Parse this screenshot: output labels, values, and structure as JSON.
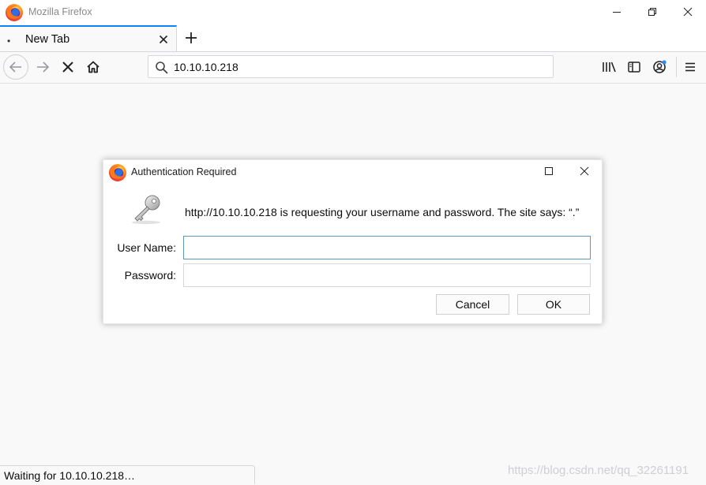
{
  "window": {
    "title": "Mozilla Firefox"
  },
  "tabs": [
    {
      "label": "New Tab",
      "bullet": "•"
    }
  ],
  "urlbar": {
    "value": "10.10.10.218"
  },
  "dialog": {
    "title": "Authentication Required",
    "message": "http://10.10.10.218 is requesting your username and password. The site says: “.”",
    "username_label": "User Name:",
    "username_value": "",
    "password_label": "Password:",
    "password_value": "",
    "cancel_label": "Cancel",
    "ok_label": "OK"
  },
  "status": {
    "text": "Waiting for 10.10.10.218…"
  },
  "watermark": {
    "text": "https://blog.csdn.net/qq_32261191"
  },
  "colors": {
    "accent": "#0a84ff",
    "focus_border": "#5b9bb5",
    "chrome_bg": "#f9f9fa"
  },
  "icons": {
    "app_logo": "firefox-logo-icon",
    "back": "back-arrow-icon",
    "forward": "forward-arrow-icon",
    "stop": "stop-icon",
    "home": "home-icon",
    "search": "search-icon",
    "library": "library-icon",
    "sidebar": "sidebar-icon",
    "account": "account-icon",
    "menu": "hamburger-menu-icon",
    "key": "key-icon"
  }
}
